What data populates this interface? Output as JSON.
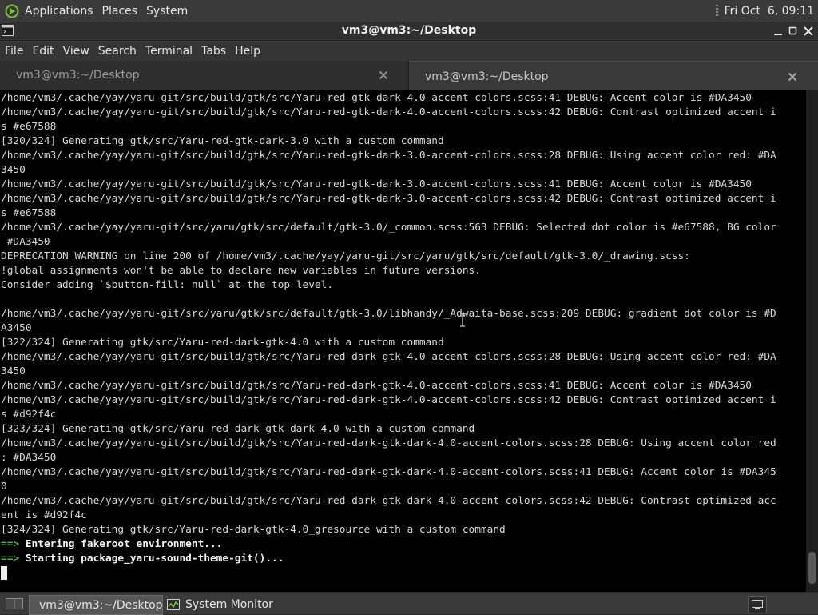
{
  "top_panel": {
    "menus": [
      "Applications",
      "Places",
      "System"
    ],
    "clock": "Fri Oct  6, 09:11"
  },
  "window": {
    "title": "vm3@vm3:~/Desktop"
  },
  "menubar": {
    "items": [
      "File",
      "Edit",
      "View",
      "Search",
      "Terminal",
      "Tabs",
      "Help"
    ]
  },
  "tabs": [
    {
      "label": "vm3@vm3:~/Desktop",
      "active": false
    },
    {
      "label": "vm3@vm3:~/Desktop",
      "active": true
    }
  ],
  "terminal": {
    "lines": [
      "/home/vm3/.cache/yay/yaru-git/src/build/gtk/src/Yaru-red-gtk-dark-4.0-accent-colors.scss:41 DEBUG: Accent color is #DA3450",
      "/home/vm3/.cache/yay/yaru-git/src/build/gtk/src/Yaru-red-gtk-dark-4.0-accent-colors.scss:42 DEBUG: Contrast optimized accent i",
      "s #e67588",
      "[320/324] Generating gtk/src/Yaru-red-gtk-dark-3.0 with a custom command",
      "/home/vm3/.cache/yay/yaru-git/src/build/gtk/src/Yaru-red-gtk-dark-3.0-accent-colors.scss:28 DEBUG: Using accent color red: #DA",
      "3450",
      "/home/vm3/.cache/yay/yaru-git/src/build/gtk/src/Yaru-red-gtk-dark-3.0-accent-colors.scss:41 DEBUG: Accent color is #DA3450",
      "/home/vm3/.cache/yay/yaru-git/src/build/gtk/src/Yaru-red-gtk-dark-3.0-accent-colors.scss:42 DEBUG: Contrast optimized accent i",
      "s #e67588",
      "/home/vm3/.cache/yay/yaru-git/src/yaru/gtk/src/default/gtk-3.0/_common.scss:563 DEBUG: Selected dot color is #e67588, BG color",
      " #DA3450",
      "DEPRECATION WARNING on line 200 of /home/vm3/.cache/yay/yaru-git/src/yaru/gtk/src/default/gtk-3.0/_drawing.scss:",
      "!global assignments won't be able to declare new variables in future versions.",
      "Consider adding `$button-fill: null` at the top level.",
      "",
      "/home/vm3/.cache/yay/yaru-git/src/yaru/gtk/src/default/gtk-3.0/libhandy/_Adwaita-base.scss:209 DEBUG: gradient dot color is #D",
      "A3450",
      "[322/324] Generating gtk/src/Yaru-red-dark-gtk-4.0 with a custom command",
      "/home/vm3/.cache/yay/yaru-git/src/build/gtk/src/Yaru-red-dark-gtk-4.0-accent-colors.scss:28 DEBUG: Using accent color red: #DA",
      "3450",
      "/home/vm3/.cache/yay/yaru-git/src/build/gtk/src/Yaru-red-dark-gtk-4.0-accent-colors.scss:41 DEBUG: Accent color is #DA3450",
      "/home/vm3/.cache/yay/yaru-git/src/build/gtk/src/Yaru-red-dark-gtk-4.0-accent-colors.scss:42 DEBUG: Contrast optimized accent i",
      "s #d92f4c",
      "[323/324] Generating gtk/src/Yaru-red-dark-gtk-dark-4.0 with a custom command",
      "/home/vm3/.cache/yay/yaru-git/src/build/gtk/src/Yaru-red-dark-gtk-dark-4.0-accent-colors.scss:28 DEBUG: Using accent color red",
      ": #DA3450",
      "/home/vm3/.cache/yay/yaru-git/src/build/gtk/src/Yaru-red-dark-gtk-dark-4.0-accent-colors.scss:41 DEBUG: Accent color is #DA345",
      "0",
      "/home/vm3/.cache/yay/yaru-git/src/build/gtk/src/Yaru-red-dark-gtk-dark-4.0-accent-colors.scss:42 DEBUG: Contrast optimized acc",
      "ent is #d92f4c",
      "[324/324] Generating gtk/src/Yaru-red-dark-gtk-4.0_gresource with a custom command"
    ],
    "status_lines": [
      {
        "arrow": "==>",
        "text": "Entering fakeroot environment..."
      },
      {
        "arrow": "==>",
        "text": "Starting package_yaru-sound-theme-git()..."
      }
    ]
  },
  "taskbar": {
    "tasks": [
      {
        "label": "vm3@vm3:~/Desktop",
        "icon": "terminal-icon",
        "active": true
      },
      {
        "label": "System Monitor",
        "icon": "system-monitor-icon",
        "active": false
      }
    ]
  },
  "colors": {
    "terminal_bg": "#000000",
    "terminal_fg": "#d8d8d8",
    "arrow_green": "#4fb04f",
    "panel_bg": "#3a3a3a"
  }
}
